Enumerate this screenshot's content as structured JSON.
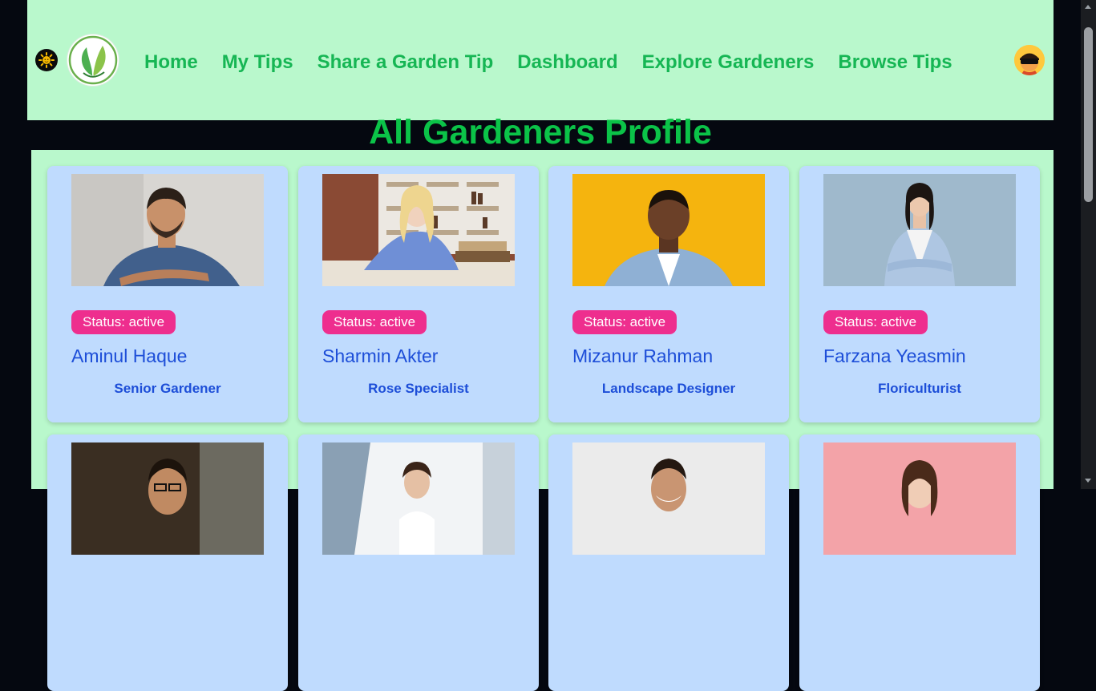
{
  "nav": {
    "links": [
      "Home",
      "My Tips",
      "Share a Garden Tip",
      "Dashboard",
      "Explore Gardeners",
      "Browse Tips"
    ],
    "theme_icon": "sun-icon",
    "logo_icon": "leaf-logo-icon",
    "avatar_icon": "user-avatar"
  },
  "page": {
    "title": "All Gardeners Profile"
  },
  "gardeners": [
    {
      "status": "Status: active",
      "name": "Aminul Haque",
      "role": "Senior Gardener"
    },
    {
      "status": "Status: active",
      "name": "Sharmin Akter",
      "role": "Rose Specialist"
    },
    {
      "status": "Status: active",
      "name": "Mizanur Rahman",
      "role": "Landscape Designer"
    },
    {
      "status": "Status: active",
      "name": "Farzana Yeasmin",
      "role": "Floriculturist"
    }
  ],
  "colors": {
    "navbar_bg": "#b9f8cc",
    "nav_link": "#16b654",
    "title": "#0bc348",
    "card_bg": "#bfdbfe",
    "status_badge": "#ee2e8e",
    "card_text": "#1d4ed8",
    "page_bg": "#050810"
  }
}
